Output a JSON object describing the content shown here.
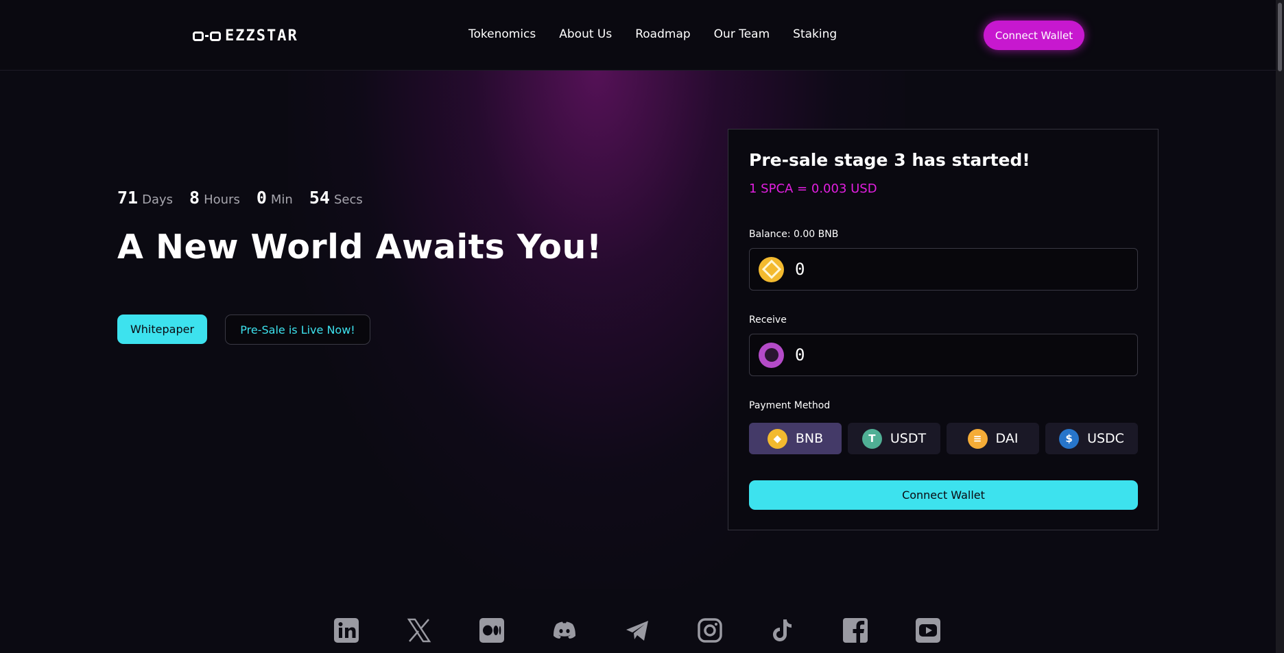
{
  "header": {
    "logo_text": "EZZSTAR",
    "nav": [
      {
        "label": "Tokenomics"
      },
      {
        "label": "About Us"
      },
      {
        "label": "Roadmap"
      },
      {
        "label": "Our Team"
      },
      {
        "label": "Staking"
      }
    ],
    "connect_label": "Connect Wallet"
  },
  "countdown": {
    "days": "71",
    "days_label": "Days",
    "hours": "8",
    "hours_label": "Hours",
    "mins": "0",
    "mins_label": "Min",
    "secs": "54",
    "secs_label": "Secs"
  },
  "hero": {
    "title": "A New World Awaits You!",
    "whitepaper_label": "Whitepaper",
    "presale_label": "Pre-Sale is Live Now!"
  },
  "presale": {
    "title": "Pre-sale stage 3 has started!",
    "rate": "1 SPCA = 0.003 USD",
    "balance_label": "Balance: 0.00 BNB",
    "pay_value": "0",
    "receive_label": "Receive",
    "receive_value": "0",
    "payment_method_label": "Payment Method",
    "methods": [
      {
        "label": "BNB",
        "icon": "bnb-coin-icon"
      },
      {
        "label": "USDT",
        "icon": "usdt-coin-icon"
      },
      {
        "label": "DAI",
        "icon": "dai-coin-icon"
      },
      {
        "label": "USDC",
        "icon": "usdc-coin-icon"
      }
    ],
    "selected_method": "BNB",
    "connect_label": "Connect Wallet"
  },
  "socials": [
    "linkedin-icon",
    "x-icon",
    "medium-icon",
    "discord-icon",
    "telegram-icon",
    "instagram-icon",
    "tiktok-icon",
    "facebook-icon",
    "youtube-icon"
  ],
  "colors": {
    "background": "#0b0a12",
    "accent_magenta": "#c718cf",
    "accent_cyan": "#3de2ee",
    "rate_pink": "#e21fe0",
    "social_gray": "#9a9aa2"
  }
}
